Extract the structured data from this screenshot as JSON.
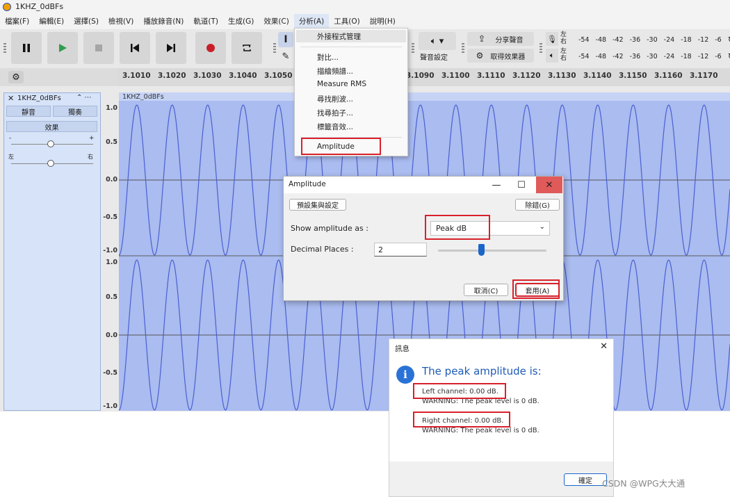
{
  "window": {
    "title": "1KHZ_0dBFs"
  },
  "menubar": [
    "檔案(F)",
    "編輯(E)",
    "選擇(S)",
    "檢視(V)",
    "播放錄音(N)",
    "軌道(T)",
    "生成(G)",
    "效果(C)",
    "分析(A)",
    "工具(O)",
    "說明(H)"
  ],
  "toolbar": {
    "audio_setup": "聲音設定",
    "share_audio": "分享聲音",
    "get_effects": "取得效果器",
    "meter_labels_rec": "左\n右",
    "meter_ticks": [
      "-54",
      "-48",
      "-42",
      "-36",
      "-30",
      "-24",
      "-18",
      "-12",
      "-6"
    ]
  },
  "ruler": {
    "ticks": [
      "3.1010",
      "3.1020",
      "3.1030",
      "3.1040",
      "3.1050",
      "3.1090",
      "3.1100",
      "3.1110",
      "3.1120",
      "3.1130",
      "3.1140",
      "3.1150",
      "3.1160",
      "3.1170"
    ]
  },
  "track": {
    "name": "1KHZ_0dBFs",
    "clip_name": "1KHZ_0dBFs",
    "mute": "靜音",
    "solo": "獨奏",
    "effects": "效果",
    "gain_minus": "-",
    "gain_plus": "+",
    "pan_left": "左",
    "pan_right": "右",
    "scale_top": [
      "1.0",
      "0.5",
      "0.0",
      "-0.5",
      "-1.0"
    ],
    "scale_bottom": [
      "1.0",
      "0.5",
      "0.0",
      "-0.5",
      "-1.0"
    ]
  },
  "analyze_menu": {
    "items": [
      "外接程式管理",
      "對比...",
      "描繪頻譜...",
      "Measure RMS",
      "尋找削波...",
      "找尋拍子...",
      "標籤音效...",
      "Amplitude"
    ],
    "highlighted": "Amplitude"
  },
  "amplitude_dialog": {
    "title": "Amplitude",
    "presets_button": "預設集與設定",
    "debug_button": "除錯(G)",
    "show_label": "Show amplitude as :",
    "show_value": "Peak dB",
    "decimal_label": "Decimal Places :",
    "decimal_value": "2",
    "decimal_slider_level": 0.4,
    "cancel_button": "取消(C)",
    "apply_button": "套用(A)",
    "minimize": "—",
    "maximize": "☐",
    "close": "✕"
  },
  "message_dialog": {
    "title": "訊息",
    "headline": "The peak amplitude is:",
    "left_channel": "Left channel: 0.00 dB.",
    "left_warning": "WARNING: The peak level is 0 dB.",
    "right_channel": "Right channel: 0.00 dB.",
    "right_warning": "WARNING: The peak level is 0 dB.",
    "ok_button": "確定",
    "close": "✕"
  },
  "watermark": "CSDN @WPG大大通",
  "colors": {
    "wave_bg": "#aabcf0",
    "wave_line": "#4a5fd0",
    "highlight_red": "#d8202a",
    "info_blue": "#2b72d6"
  }
}
